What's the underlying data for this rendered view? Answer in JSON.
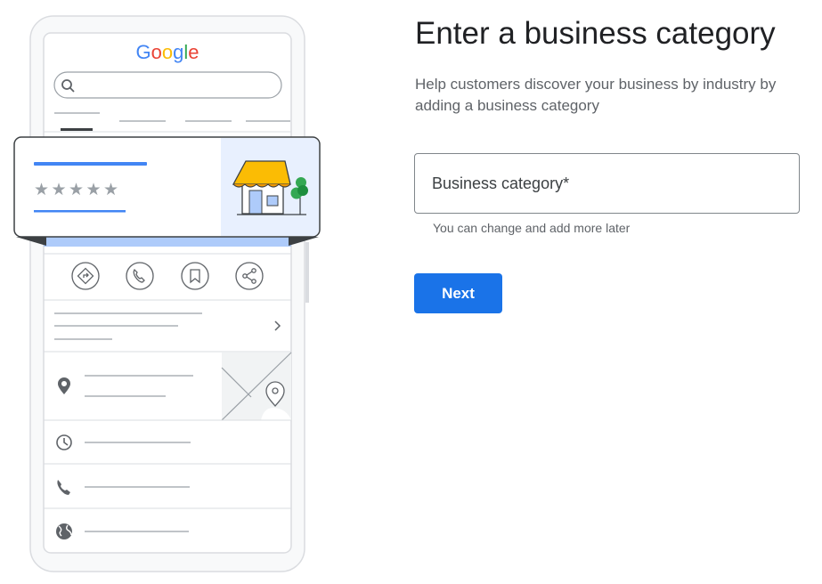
{
  "illustration": {
    "logo_text": "Google",
    "logo_colors": [
      "#4285F4",
      "#EA4335",
      "#FBBC05",
      "#4285F4",
      "#34A853",
      "#EA4335"
    ],
    "rating_stars": 5,
    "accent_blue": "#4285f4",
    "awning_yellow": "#fbbc04",
    "tree_green": "#34a853"
  },
  "form": {
    "title": "Enter a business category",
    "description": "Help customers discover your business by industry by adding a business category",
    "category_placeholder": "Business category*",
    "category_value": "",
    "helper_text": "You can change and add more later",
    "next_label": "Next"
  }
}
